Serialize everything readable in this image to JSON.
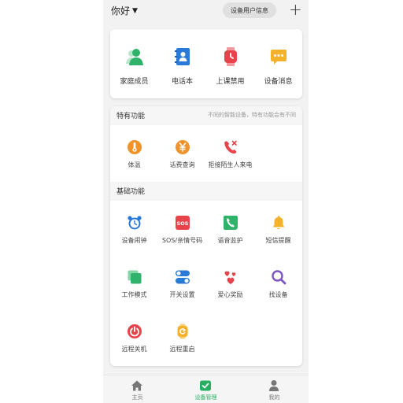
{
  "header": {
    "greeting": "你好",
    "device_info_button": "设备用户信息"
  },
  "quick_actions": [
    {
      "label": "家庭成员",
      "icon": "family-members-icon"
    },
    {
      "label": "电话本",
      "icon": "phonebook-icon"
    },
    {
      "label": "上课禁用",
      "icon": "class-disable-icon"
    },
    {
      "label": "设备消息",
      "icon": "device-message-icon"
    }
  ],
  "special": {
    "title": "特有功能",
    "desc": "不同的智能设备，特有功能会有不同",
    "items": [
      {
        "label": "体温",
        "icon": "thermometer-icon"
      },
      {
        "label": "话费查询",
        "icon": "phone-bill-icon"
      },
      {
        "label": "拒接陌生人来电",
        "icon": "reject-stranger-call-icon"
      }
    ]
  },
  "basic": {
    "title": "基础功能",
    "items": [
      {
        "label": "设备闹钟",
        "icon": "alarm-clock-icon"
      },
      {
        "label": "SOS/亲情号码",
        "icon": "sos-icon"
      },
      {
        "label": "语音监护",
        "icon": "voice-monitor-icon"
      },
      {
        "label": "短信提醒",
        "icon": "bell-icon"
      },
      {
        "label": "工作模式",
        "icon": "work-mode-icon"
      },
      {
        "label": "开关设置",
        "icon": "toggle-settings-icon"
      },
      {
        "label": "爱心奖励",
        "icon": "hearts-icon"
      },
      {
        "label": "找设备",
        "icon": "search-icon"
      },
      {
        "label": "远程关机",
        "icon": "power-icon"
      },
      {
        "label": "远程重启",
        "icon": "restart-icon"
      }
    ]
  },
  "tabs": [
    {
      "label": "主页",
      "icon": "home-icon",
      "active": false
    },
    {
      "label": "设备管理",
      "icon": "device-manage-icon",
      "active": true
    },
    {
      "label": "我的",
      "icon": "profile-icon",
      "active": false
    }
  ],
  "colors": {
    "accent": "#27ae60",
    "orange": "#f0932b",
    "red": "#e8424a",
    "blue": "#2979d9"
  }
}
